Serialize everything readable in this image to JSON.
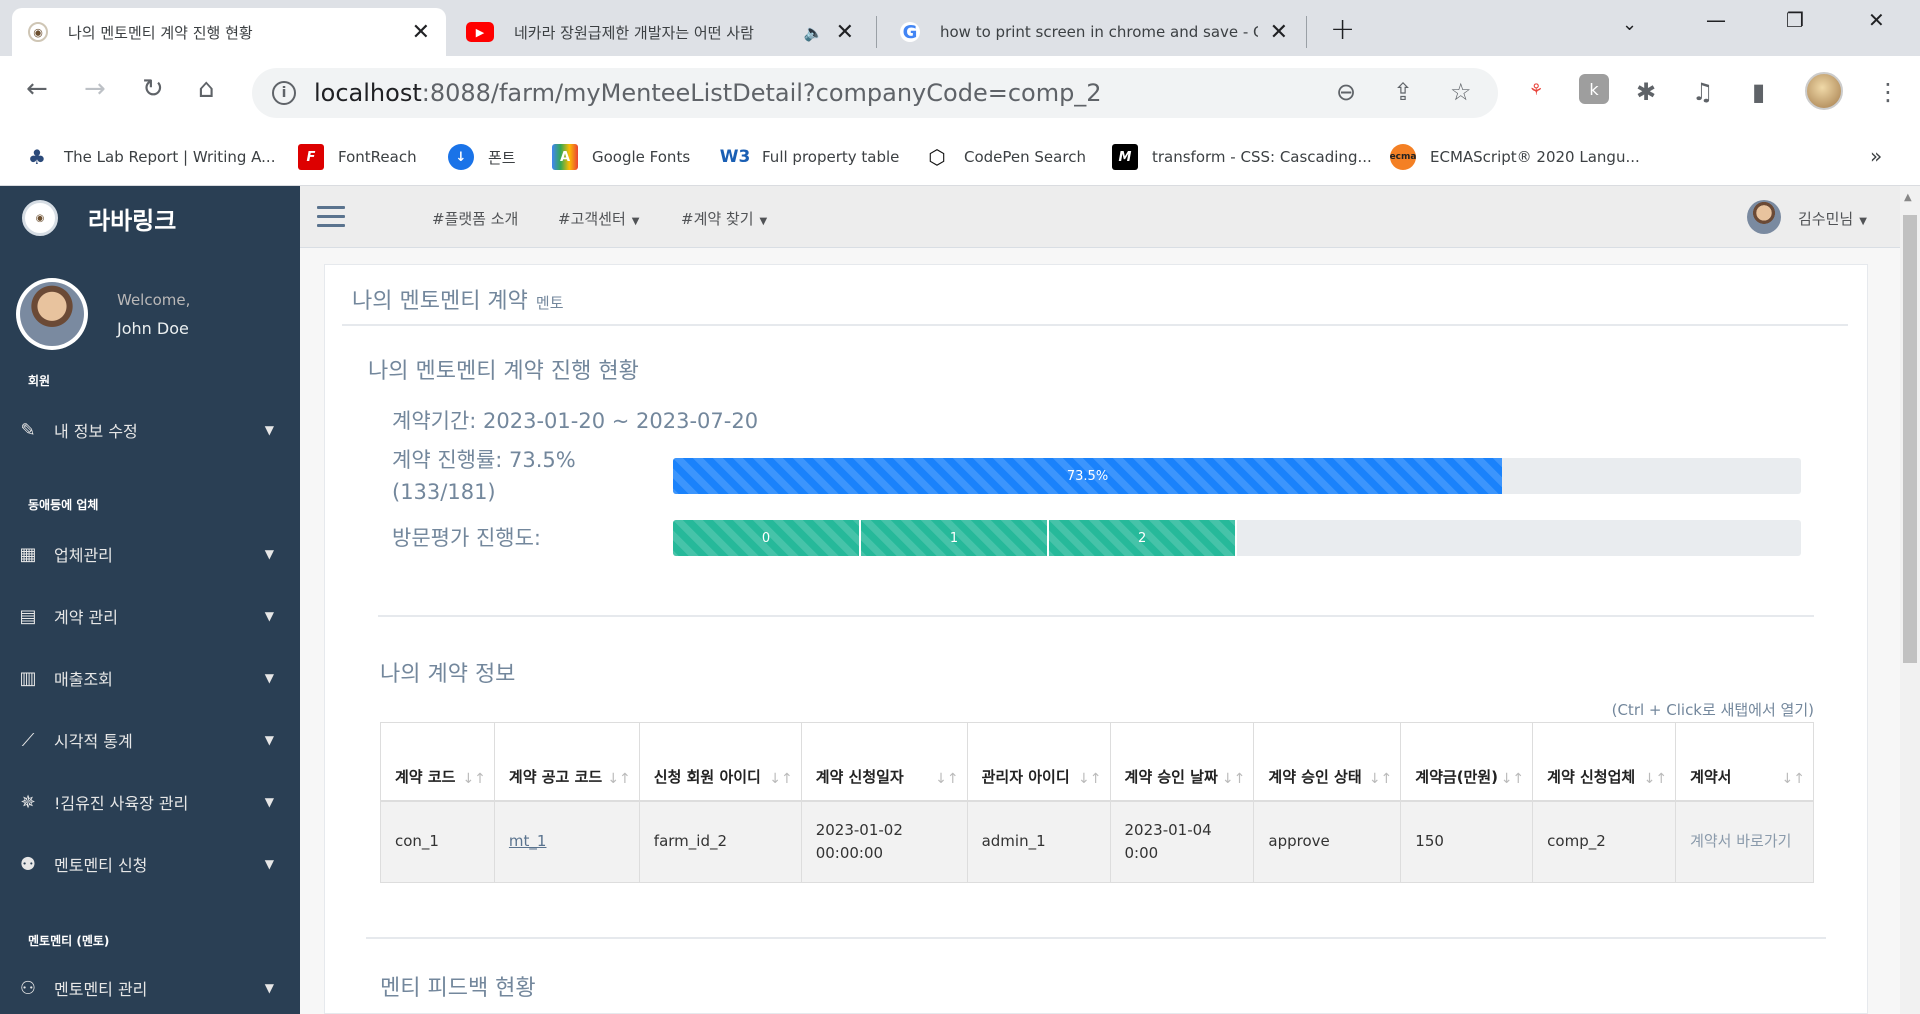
{
  "browser": {
    "tabs": [
      {
        "title": "나의 멘토멘티 계약 진행 현황",
        "active": true
      },
      {
        "title": "네카라 장원급제한 개발자는 어떤 사람",
        "active": false
      },
      {
        "title": "how to print screen in chrome and save - Go",
        "active": false
      }
    ],
    "url_host": "localhost",
    "url_rest": ":8088/farm/myMenteeListDetail?companyCode=comp_2",
    "bookmarks": [
      {
        "label": "The Lab Report | Writing A..."
      },
      {
        "label": "FontReach"
      },
      {
        "label": "폰트"
      },
      {
        "label": "Google Fonts"
      },
      {
        "label": "Full property table"
      },
      {
        "label": "CodePen Search"
      },
      {
        "label": "transform - CSS: Cascading..."
      },
      {
        "label": "ECMAScript® 2020 Langu..."
      }
    ]
  },
  "sidebar": {
    "brand": "라바링크",
    "welcome": "Welcome,",
    "user": "John Doe",
    "sections": [
      {
        "title": "회원"
      },
      {
        "title": "동애등에 업체"
      },
      {
        "title": "멘토멘티 (멘토)"
      }
    ],
    "items": [
      {
        "label": "내 정보 수정",
        "icon": "edit-icon"
      },
      {
        "label": "업체관리",
        "icon": "building-icon"
      },
      {
        "label": "계약 관리",
        "icon": "document-icon"
      },
      {
        "label": "매출조회",
        "icon": "bar-chart-icon"
      },
      {
        "label": "시각적 통계",
        "icon": "line-chart-icon"
      },
      {
        "label": "!김유진 사육장 관리",
        "icon": "bug-icon"
      },
      {
        "label": "멘토멘티 신청",
        "icon": "user-plus-icon"
      },
      {
        "label": "멘토멘티 관리",
        "icon": "users-icon"
      }
    ]
  },
  "topnav": {
    "links": [
      "#플랫폼 소개",
      "#고객센터",
      "#계약 찾기"
    ],
    "user": "김수민님"
  },
  "main": {
    "title": "나의 멘토멘티 계약",
    "title_small": "멘토",
    "progress_heading": "나의 멘토멘티 계약 진행 현황",
    "period_text": "계약기간: 2023-01-20 ~ 2023-07-20",
    "rate_text": "계약 진행률: 73.5%",
    "rate_detail": "(133/181)",
    "rate_label": "73.5%",
    "rate_fraction": 0.735,
    "eval_text": "방문평가 진행도:",
    "eval_segments": [
      "0",
      "1",
      "2"
    ],
    "eval_segment_fraction": 0.1667,
    "contract_heading": "나의 계약 정보",
    "ctrl_hint": "(Ctrl + Click로 새탭에서 열기)",
    "table": {
      "headers": [
        "계약 코드",
        "계약 공고 코드",
        "신청 회원 아이디",
        "계약 신청일자",
        "관리자 아이디",
        "계약 승인 날짜",
        "계약 승인 상태",
        "계약금(만원)",
        "계약 신청업체",
        "계약서"
      ],
      "row": [
        "con_1",
        "mt_1",
        "farm_id_2",
        "2023-01-02 00:00:00",
        "admin_1",
        "2023-01-04 0:00",
        "approve",
        "150",
        "comp_2",
        "계약서 바로가기"
      ]
    },
    "feedback_heading": "멘티 피드백 현황"
  },
  "colors": {
    "sidebar_bg": "#2a3f54",
    "progress_blue": "#1a82fb",
    "eval_green": "#26B99A"
  }
}
